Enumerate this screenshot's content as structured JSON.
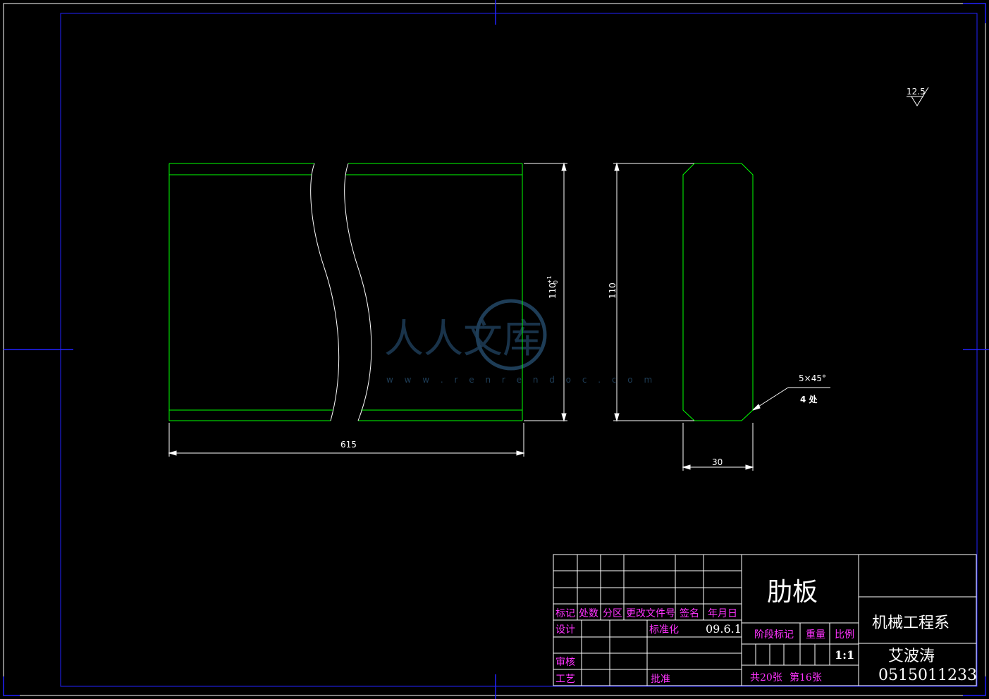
{
  "drawing": {
    "surface_roughness": "12.5",
    "dim_length": "615",
    "dim_height_tol_base": "110",
    "dim_height_tol_upper": "+1",
    "dim_height_tol_lower": "0",
    "dim_height": "110",
    "dim_width": "30",
    "chamfer_label": "5×45°",
    "chamfer_count": "4 处"
  },
  "watermark": {
    "text": "人人文库",
    "url": "w w w . r e n r e n d o c . c o m"
  },
  "title_block": {
    "part_name": "肋板",
    "department": "机械工程系",
    "designer_name": "艾波涛",
    "student_id": "0515011233",
    "header_mark": "标记",
    "header_count": "处数",
    "header_zone": "分区",
    "header_doc": "更改文件号",
    "header_sign": "签名",
    "header_date": "年月日",
    "design_label": "设计",
    "standardize_label": "标准化",
    "design_date": "09.6.1",
    "stage_label": "阶段标记",
    "weight_label": "重量",
    "scale_label": "比例",
    "scale_value": "1:1",
    "review_label": "审核",
    "process_label": "工艺",
    "approve_label": "批准",
    "total_sheets": "共20张",
    "sheet_no": "第16张"
  },
  "colors": {
    "background": "#000000",
    "border": "#0000ff",
    "part_outline": "#00ff00",
    "dimension": "#ffffff",
    "title_text": "#ff33ff"
  }
}
